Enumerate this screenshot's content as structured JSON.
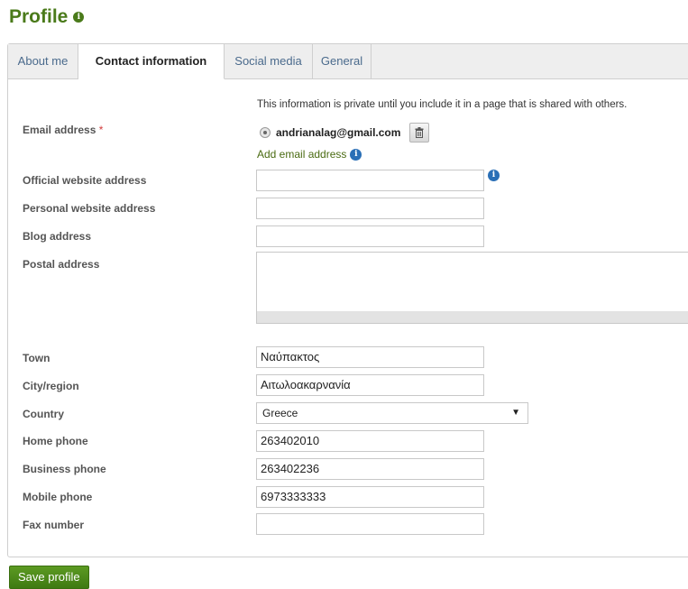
{
  "page": {
    "title": "Profile"
  },
  "tabs": [
    {
      "label": "About me"
    },
    {
      "label": "Contact information"
    },
    {
      "label": "Social media"
    },
    {
      "label": "General"
    }
  ],
  "form": {
    "intro": "This information is private until you include it in a page that is shared with others.",
    "email": {
      "label": "Email address",
      "required_mark": "*",
      "value": "andrianalag@gmail.com",
      "add_link": "Add email address"
    },
    "fields": {
      "official_website": {
        "label": "Official website address",
        "value": ""
      },
      "personal_website": {
        "label": "Personal website address",
        "value": ""
      },
      "blog": {
        "label": "Blog address",
        "value": ""
      },
      "postal": {
        "label": "Postal address",
        "value": ""
      },
      "town": {
        "label": "Town",
        "value": "Ναύπακτος"
      },
      "city": {
        "label": "City/region",
        "value": "Αιτωλοακαρνανία"
      },
      "country": {
        "label": "Country",
        "value": "Greece"
      },
      "home_phone": {
        "label": "Home phone",
        "value": "263402010"
      },
      "business_phone": {
        "label": "Business phone",
        "value": "263402236"
      },
      "mobile_phone": {
        "label": "Mobile phone",
        "value": "6973333333"
      },
      "fax": {
        "label": "Fax number",
        "value": ""
      }
    }
  },
  "save_button": "Save profile",
  "icons": {
    "title_info": "info-icon",
    "email_delete": "trash-icon",
    "add_email_info": "info-icon",
    "website_info": "info-icon",
    "select_arrow": "triangle-down-icon"
  },
  "colors": {
    "accent": "#4a7a1a",
    "info_blue": "#2a6fb6",
    "required": "#d23b3b"
  }
}
